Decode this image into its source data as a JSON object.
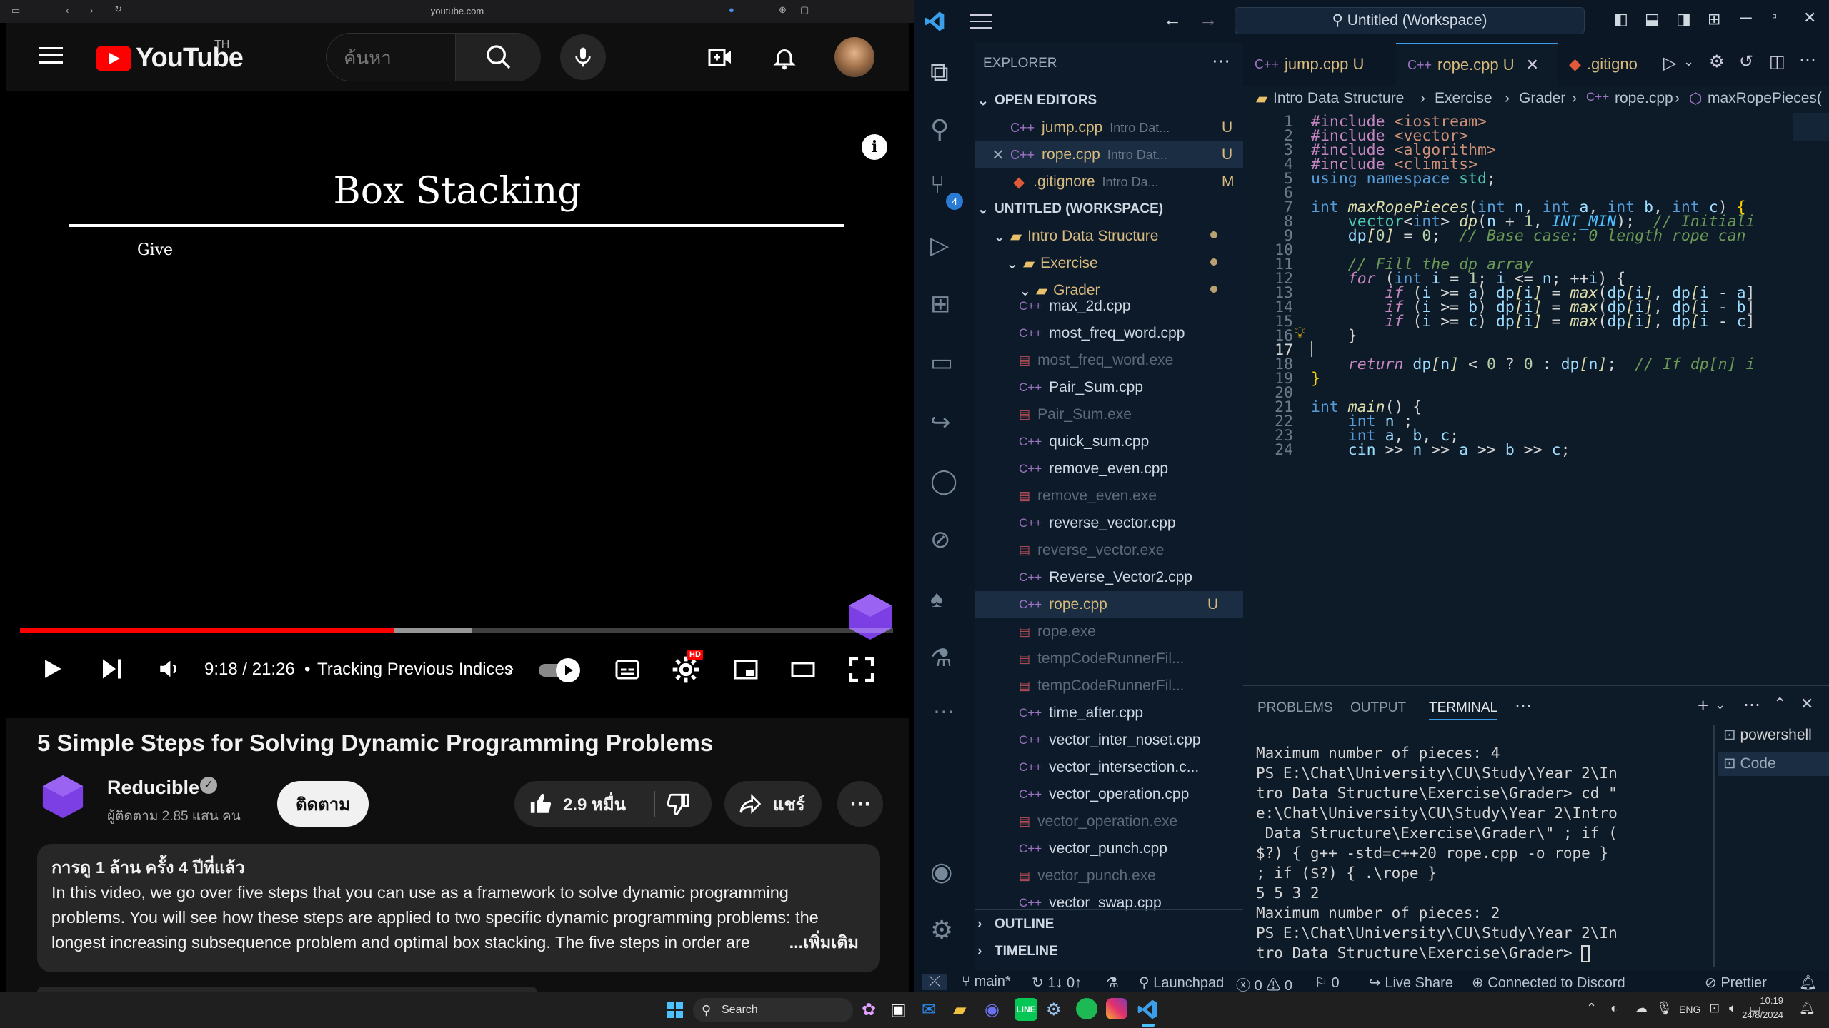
{
  "browser": {
    "url": "youtube.com"
  },
  "youtube": {
    "logo_text": "YouTube",
    "region": "TH",
    "search_placeholder": "ค้นหา",
    "video_slide_title": "Box Stacking",
    "video_slide_sub": "Give",
    "time": "9:18 / 21:26",
    "chapter": "Tracking Previous Indices",
    "progress": {
      "played_fraction": 0.428,
      "loaded_fraction": 0.518
    },
    "hd_badge": "HD",
    "title": "5 Simple Steps for Solving Dynamic Programming Problems",
    "channel": "Reducible",
    "subscribers": "ผู้ติดตาม 2.85 แสน คน",
    "subscribe_label": "ติดตาม",
    "likes": "2.9 หมื่น",
    "share_label": "แชร์",
    "desc_meta": "การดู 1 ล้าน ครั้ง  4 ปีที่แล้ว",
    "desc_text": "In this video, we go over five steps that you can use as a framework to solve dynamic programming problems. You will see how these steps are applied to two specific dynamic programming problems: the longest increasing subsequence problem and optimal box stacking. The five steps in order are",
    "desc_more": "...เพิ่มเติม"
  },
  "vscode": {
    "title": "Untitled (Workspace)",
    "explorer_label": "EXPLORER",
    "open_editors": "OPEN EDITORS",
    "workspace": "UNTITLED (WORKSPACE)",
    "source_control_badge": "4",
    "open_files": [
      {
        "name": "jump.cpp",
        "path": "Intro Dat...",
        "status": "U"
      },
      {
        "name": "rope.cpp",
        "path": "Intro Dat...",
        "status": "U"
      },
      {
        "name": ".gitignore",
        "path": "Intro Da...",
        "status": "M"
      }
    ],
    "folders": [
      "Intro Data Structure",
      "Exercise",
      "Grader"
    ],
    "files": [
      "max_2d.cpp",
      "most_freq_word.cpp",
      "most_freq_word.exe",
      "Pair_Sum.cpp",
      "Pair_Sum.exe",
      "quick_sum.cpp",
      "remove_even.cpp",
      "remove_even.exe",
      "reverse_vector.cpp",
      "reverse_vector.exe",
      "Reverse_Vector2.cpp",
      "rope.cpp",
      "rope.exe",
      "tempCodeRunnerFil...",
      "tempCodeRunnerFil...",
      "time_after.cpp",
      "vector_inter_noset.cpp",
      "vector_intersection.c...",
      "vector_operation.cpp",
      "vector_operation.exe",
      "vector_punch.cpp",
      "vector_punch.exe",
      "vector_swap.cpp"
    ],
    "rope_status": "U",
    "outline": "OUTLINE",
    "timeline": "TIMELINE",
    "tabs": [
      {
        "label": "jump.cpp",
        "status": "U"
      },
      {
        "label": "rope.cpp",
        "status": "U"
      },
      {
        "label": ".gitigno"
      }
    ],
    "breadcrumb": [
      "Intro Data Structure",
      "Exercise",
      "Grader",
      "rope.cpp",
      "maxRopePieces("
    ],
    "panel_tabs": [
      "PROBLEMS",
      "OUTPUT",
      "TERMINAL"
    ],
    "terminal_lines": [
      "Maximum number of pieces: 4",
      "PS E:\\Chat\\University\\CU\\Study\\Year 2\\In",
      "tro Data Structure\\Exercise\\Grader> cd \"",
      "e:\\Chat\\University\\CU\\Study\\Year 2\\Intro",
      " Data Structure\\Exercise\\Grader\\\" ; if (",
      "$?) { g++ -std=c++20 rope.cpp -o rope }",
      "; if ($?) { .\\rope }",
      "5 5 3 2",
      "Maximum number of pieces: 2",
      "PS E:\\Chat\\University\\CU\\Study\\Year 2\\In",
      "tro Data Structure\\Exercise\\Grader> "
    ],
    "terminals": [
      "powershell",
      "Code"
    ],
    "status": {
      "branch": "main*",
      "sync": "1↓ 0↑",
      "launchpad": "Launchpad",
      "errors": "0",
      "warnings": "0",
      "ports": "0",
      "liveshare": "Live Share",
      "discord": "Connected to Discord",
      "prettier": "Prettier"
    }
  },
  "taskbar": {
    "search": "Search",
    "lang": "ENG",
    "time": "10:19",
    "date": "24/8/2024"
  }
}
